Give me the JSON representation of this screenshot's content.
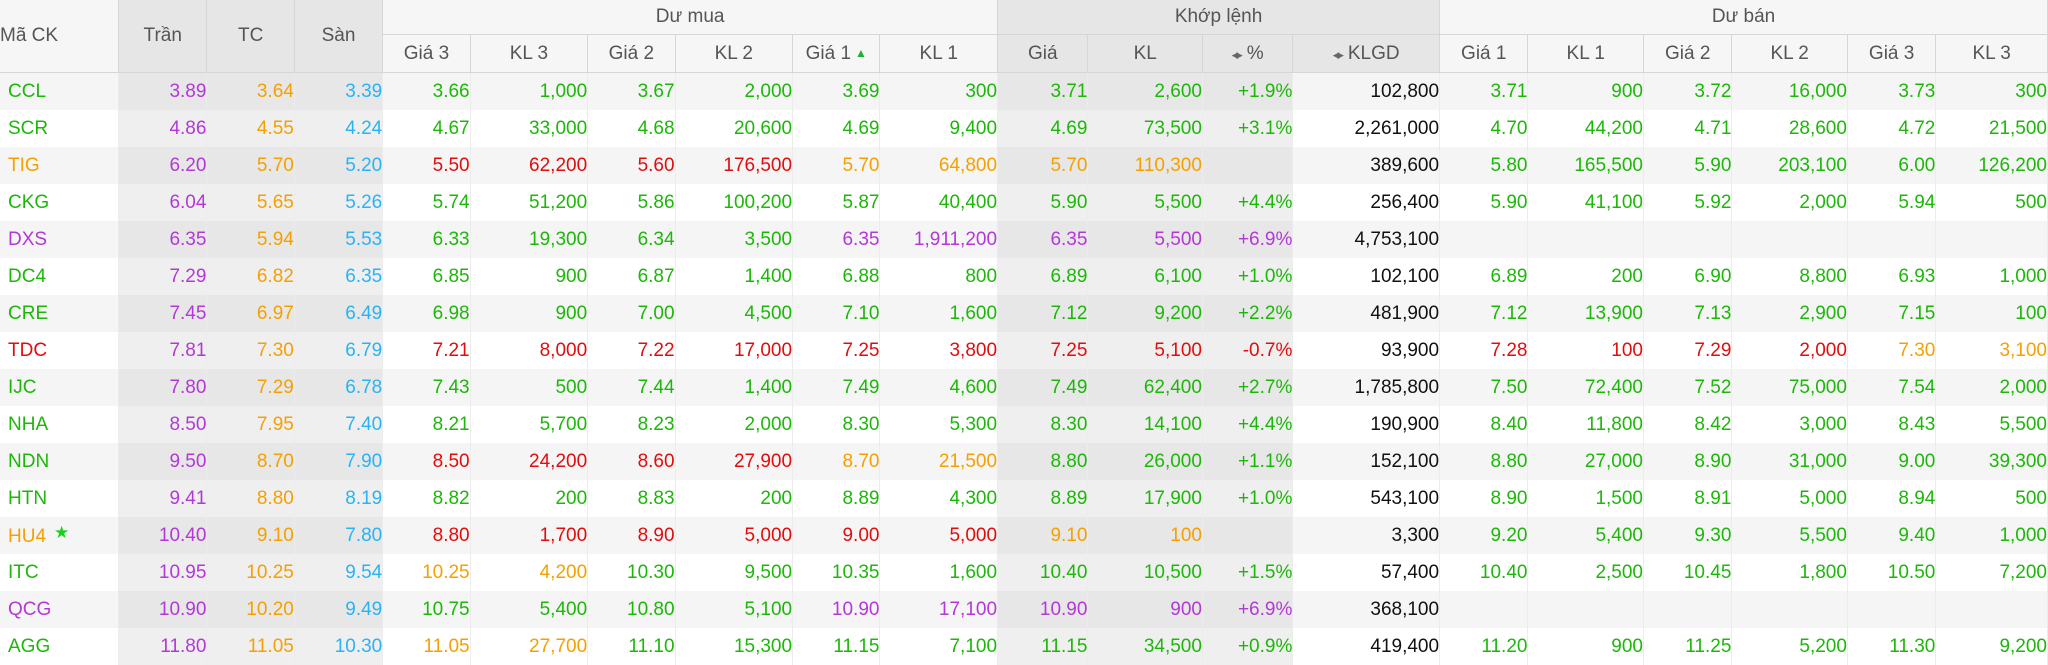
{
  "colors": {
    "g": "#1db70a",
    "r": "#e10d0d",
    "y": "#f5a000",
    "p": "#b438d8",
    "c": "#29b3f5",
    "k": "#111111"
  },
  "header": {
    "ma_ck": "Mã CK",
    "tran": "Trần",
    "tc": "TC",
    "san": "Sàn",
    "du_mua": "Dư mua",
    "khop_lenh": "Khớp lệnh",
    "du_ban": "Dư bán",
    "sort_icon": "◂▸",
    "buy_cols": [
      "Giá 3",
      "KL 3",
      "Giá 2",
      "KL 2",
      "Giá 1",
      "KL 1"
    ],
    "match_cols": [
      "Giá",
      "KL",
      "%",
      "KLGD"
    ],
    "sell_cols": [
      "Giá 1",
      "KL 1",
      "Giá 2",
      "KL 2",
      "Giá 3",
      "KL 3"
    ]
  },
  "rows": [
    {
      "sym": "CCL",
      "sc": "g",
      "star": false,
      "tran": "3.89",
      "tc": "3.64",
      "san": "3.39",
      "b": [
        [
          "3.66",
          "g"
        ],
        [
          "1,000",
          "g"
        ],
        [
          "3.67",
          "g"
        ],
        [
          "2,000",
          "g"
        ],
        [
          "3.69",
          "g"
        ],
        [
          "300",
          "g"
        ]
      ],
      "m": [
        [
          "3.71",
          "g"
        ],
        [
          "2,600",
          "g"
        ],
        [
          "+1.9%",
          "g"
        ]
      ],
      "klgd": "102,800",
      "s": [
        [
          "3.71",
          "g"
        ],
        [
          "900",
          "g"
        ],
        [
          "3.72",
          "g"
        ],
        [
          "16,000",
          "g"
        ],
        [
          "3.73",
          "g"
        ],
        [
          "300",
          "g"
        ]
      ]
    },
    {
      "sym": "SCR",
      "sc": "g",
      "star": false,
      "tran": "4.86",
      "tc": "4.55",
      "san": "4.24",
      "b": [
        [
          "4.67",
          "g"
        ],
        [
          "33,000",
          "g"
        ],
        [
          "4.68",
          "g"
        ],
        [
          "20,600",
          "g"
        ],
        [
          "4.69",
          "g"
        ],
        [
          "9,400",
          "g"
        ]
      ],
      "m": [
        [
          "4.69",
          "g"
        ],
        [
          "73,500",
          "g"
        ],
        [
          "+3.1%",
          "g"
        ]
      ],
      "klgd": "2,261,000",
      "s": [
        [
          "4.70",
          "g"
        ],
        [
          "44,200",
          "g"
        ],
        [
          "4.71",
          "g"
        ],
        [
          "28,600",
          "g"
        ],
        [
          "4.72",
          "g"
        ],
        [
          "21,500",
          "g"
        ]
      ]
    },
    {
      "sym": "TIG",
      "sc": "y",
      "star": false,
      "tran": "6.20",
      "tc": "5.70",
      "san": "5.20",
      "b": [
        [
          "5.50",
          "r"
        ],
        [
          "62,200",
          "r"
        ],
        [
          "5.60",
          "r"
        ],
        [
          "176,500",
          "r"
        ],
        [
          "5.70",
          "y"
        ],
        [
          "64,800",
          "y"
        ]
      ],
      "m": [
        [
          "5.70",
          "y"
        ],
        [
          "110,300",
          "y"
        ],
        [
          "",
          "y"
        ]
      ],
      "klgd": "389,600",
      "s": [
        [
          "5.80",
          "g"
        ],
        [
          "165,500",
          "g"
        ],
        [
          "5.90",
          "g"
        ],
        [
          "203,100",
          "g"
        ],
        [
          "6.00",
          "g"
        ],
        [
          "126,200",
          "g"
        ]
      ]
    },
    {
      "sym": "CKG",
      "sc": "g",
      "star": false,
      "tran": "6.04",
      "tc": "5.65",
      "san": "5.26",
      "b": [
        [
          "5.74",
          "g"
        ],
        [
          "51,200",
          "g"
        ],
        [
          "5.86",
          "g"
        ],
        [
          "100,200",
          "g"
        ],
        [
          "5.87",
          "g"
        ],
        [
          "40,400",
          "g"
        ]
      ],
      "m": [
        [
          "5.90",
          "g"
        ],
        [
          "5,500",
          "g"
        ],
        [
          "+4.4%",
          "g"
        ]
      ],
      "klgd": "256,400",
      "s": [
        [
          "5.90",
          "g"
        ],
        [
          "41,100",
          "g"
        ],
        [
          "5.92",
          "g"
        ],
        [
          "2,000",
          "g"
        ],
        [
          "5.94",
          "g"
        ],
        [
          "500",
          "g"
        ]
      ]
    },
    {
      "sym": "DXS",
      "sc": "p",
      "star": false,
      "tran": "6.35",
      "tc": "5.94",
      "san": "5.53",
      "b": [
        [
          "6.33",
          "g"
        ],
        [
          "19,300",
          "g"
        ],
        [
          "6.34",
          "g"
        ],
        [
          "3,500",
          "g"
        ],
        [
          "6.35",
          "p"
        ],
        [
          "1,911,200",
          "p"
        ]
      ],
      "m": [
        [
          "6.35",
          "p"
        ],
        [
          "5,500",
          "p"
        ],
        [
          "+6.9%",
          "p"
        ]
      ],
      "klgd": "4,753,100",
      "s": [
        [
          "",
          "g"
        ],
        [
          "",
          "g"
        ],
        [
          "",
          "g"
        ],
        [
          "",
          "g"
        ],
        [
          "",
          "g"
        ],
        [
          "",
          "g"
        ]
      ]
    },
    {
      "sym": "DC4",
      "sc": "g",
      "star": false,
      "tran": "7.29",
      "tc": "6.82",
      "san": "6.35",
      "b": [
        [
          "6.85",
          "g"
        ],
        [
          "900",
          "g"
        ],
        [
          "6.87",
          "g"
        ],
        [
          "1,400",
          "g"
        ],
        [
          "6.88",
          "g"
        ],
        [
          "800",
          "g"
        ]
      ],
      "m": [
        [
          "6.89",
          "g"
        ],
        [
          "6,100",
          "g"
        ],
        [
          "+1.0%",
          "g"
        ]
      ],
      "klgd": "102,100",
      "s": [
        [
          "6.89",
          "g"
        ],
        [
          "200",
          "g"
        ],
        [
          "6.90",
          "g"
        ],
        [
          "8,800",
          "g"
        ],
        [
          "6.93",
          "g"
        ],
        [
          "1,000",
          "g"
        ]
      ]
    },
    {
      "sym": "CRE",
      "sc": "g",
      "star": false,
      "tran": "7.45",
      "tc": "6.97",
      "san": "6.49",
      "b": [
        [
          "6.98",
          "g"
        ],
        [
          "900",
          "g"
        ],
        [
          "7.00",
          "g"
        ],
        [
          "4,500",
          "g"
        ],
        [
          "7.10",
          "g"
        ],
        [
          "1,600",
          "g"
        ]
      ],
      "m": [
        [
          "7.12",
          "g"
        ],
        [
          "9,200",
          "g"
        ],
        [
          "+2.2%",
          "g"
        ]
      ],
      "klgd": "481,900",
      "s": [
        [
          "7.12",
          "g"
        ],
        [
          "13,900",
          "g"
        ],
        [
          "7.13",
          "g"
        ],
        [
          "2,900",
          "g"
        ],
        [
          "7.15",
          "g"
        ],
        [
          "100",
          "g"
        ]
      ]
    },
    {
      "sym": "TDC",
      "sc": "r",
      "star": false,
      "tran": "7.81",
      "tc": "7.30",
      "san": "6.79",
      "b": [
        [
          "7.21",
          "r"
        ],
        [
          "8,000",
          "r"
        ],
        [
          "7.22",
          "r"
        ],
        [
          "17,000",
          "r"
        ],
        [
          "7.25",
          "r"
        ],
        [
          "3,800",
          "r"
        ]
      ],
      "m": [
        [
          "7.25",
          "r"
        ],
        [
          "5,100",
          "r"
        ],
        [
          "-0.7%",
          "r"
        ]
      ],
      "klgd": "93,900",
      "s": [
        [
          "7.28",
          "r"
        ],
        [
          "100",
          "r"
        ],
        [
          "7.29",
          "r"
        ],
        [
          "2,000",
          "r"
        ],
        [
          "7.30",
          "y"
        ],
        [
          "3,100",
          "y"
        ]
      ]
    },
    {
      "sym": "IJC",
      "sc": "g",
      "star": false,
      "tran": "7.80",
      "tc": "7.29",
      "san": "6.78",
      "b": [
        [
          "7.43",
          "g"
        ],
        [
          "500",
          "g"
        ],
        [
          "7.44",
          "g"
        ],
        [
          "1,400",
          "g"
        ],
        [
          "7.49",
          "g"
        ],
        [
          "4,600",
          "g"
        ]
      ],
      "m": [
        [
          "7.49",
          "g"
        ],
        [
          "62,400",
          "g"
        ],
        [
          "+2.7%",
          "g"
        ]
      ],
      "klgd": "1,785,800",
      "s": [
        [
          "7.50",
          "g"
        ],
        [
          "72,400",
          "g"
        ],
        [
          "7.52",
          "g"
        ],
        [
          "75,000",
          "g"
        ],
        [
          "7.54",
          "g"
        ],
        [
          "2,000",
          "g"
        ]
      ]
    },
    {
      "sym": "NHA",
      "sc": "g",
      "star": false,
      "tran": "8.50",
      "tc": "7.95",
      "san": "7.40",
      "b": [
        [
          "8.21",
          "g"
        ],
        [
          "5,700",
          "g"
        ],
        [
          "8.23",
          "g"
        ],
        [
          "2,000",
          "g"
        ],
        [
          "8.30",
          "g"
        ],
        [
          "5,300",
          "g"
        ]
      ],
      "m": [
        [
          "8.30",
          "g"
        ],
        [
          "14,100",
          "g"
        ],
        [
          "+4.4%",
          "g"
        ]
      ],
      "klgd": "190,900",
      "s": [
        [
          "8.40",
          "g"
        ],
        [
          "11,800",
          "g"
        ],
        [
          "8.42",
          "g"
        ],
        [
          "3,000",
          "g"
        ],
        [
          "8.43",
          "g"
        ],
        [
          "5,500",
          "g"
        ]
      ]
    },
    {
      "sym": "NDN",
      "sc": "g",
      "star": false,
      "tran": "9.50",
      "tc": "8.70",
      "san": "7.90",
      "b": [
        [
          "8.50",
          "r"
        ],
        [
          "24,200",
          "r"
        ],
        [
          "8.60",
          "r"
        ],
        [
          "27,900",
          "r"
        ],
        [
          "8.70",
          "y"
        ],
        [
          "21,500",
          "y"
        ]
      ],
      "m": [
        [
          "8.80",
          "g"
        ],
        [
          "26,000",
          "g"
        ],
        [
          "+1.1%",
          "g"
        ]
      ],
      "klgd": "152,100",
      "s": [
        [
          "8.80",
          "g"
        ],
        [
          "27,000",
          "g"
        ],
        [
          "8.90",
          "g"
        ],
        [
          "31,000",
          "g"
        ],
        [
          "9.00",
          "g"
        ],
        [
          "39,300",
          "g"
        ]
      ]
    },
    {
      "sym": "HTN",
      "sc": "g",
      "star": false,
      "tran": "9.41",
      "tc": "8.80",
      "san": "8.19",
      "b": [
        [
          "8.82",
          "g"
        ],
        [
          "200",
          "g"
        ],
        [
          "8.83",
          "g"
        ],
        [
          "200",
          "g"
        ],
        [
          "8.89",
          "g"
        ],
        [
          "4,300",
          "g"
        ]
      ],
      "m": [
        [
          "8.89",
          "g"
        ],
        [
          "17,900",
          "g"
        ],
        [
          "+1.0%",
          "g"
        ]
      ],
      "klgd": "543,100",
      "s": [
        [
          "8.90",
          "g"
        ],
        [
          "1,500",
          "g"
        ],
        [
          "8.91",
          "g"
        ],
        [
          "5,000",
          "g"
        ],
        [
          "8.94",
          "g"
        ],
        [
          "500",
          "g"
        ]
      ]
    },
    {
      "sym": "HU4",
      "sc": "y",
      "star": true,
      "tran": "10.40",
      "tc": "9.10",
      "san": "7.80",
      "b": [
        [
          "8.80",
          "r"
        ],
        [
          "1,700",
          "r"
        ],
        [
          "8.90",
          "r"
        ],
        [
          "5,000",
          "r"
        ],
        [
          "9.00",
          "r"
        ],
        [
          "5,000",
          "r"
        ]
      ],
      "m": [
        [
          "9.10",
          "y"
        ],
        [
          "100",
          "y"
        ],
        [
          "",
          "y"
        ]
      ],
      "klgd": "3,300",
      "s": [
        [
          "9.20",
          "g"
        ],
        [
          "5,400",
          "g"
        ],
        [
          "9.30",
          "g"
        ],
        [
          "5,500",
          "g"
        ],
        [
          "9.40",
          "g"
        ],
        [
          "1,000",
          "g"
        ]
      ]
    },
    {
      "sym": "ITC",
      "sc": "g",
      "star": false,
      "tran": "10.95",
      "tc": "10.25",
      "san": "9.54",
      "b": [
        [
          "10.25",
          "y"
        ],
        [
          "4,200",
          "y"
        ],
        [
          "10.30",
          "g"
        ],
        [
          "9,500",
          "g"
        ],
        [
          "10.35",
          "g"
        ],
        [
          "1,600",
          "g"
        ]
      ],
      "m": [
        [
          "10.40",
          "g"
        ],
        [
          "10,500",
          "g"
        ],
        [
          "+1.5%",
          "g"
        ]
      ],
      "klgd": "57,400",
      "s": [
        [
          "10.40",
          "g"
        ],
        [
          "2,500",
          "g"
        ],
        [
          "10.45",
          "g"
        ],
        [
          "1,800",
          "g"
        ],
        [
          "10.50",
          "g"
        ],
        [
          "7,200",
          "g"
        ]
      ]
    },
    {
      "sym": "QCG",
      "sc": "p",
      "star": false,
      "tran": "10.90",
      "tc": "10.20",
      "san": "9.49",
      "b": [
        [
          "10.75",
          "g"
        ],
        [
          "5,400",
          "g"
        ],
        [
          "10.80",
          "g"
        ],
        [
          "5,100",
          "g"
        ],
        [
          "10.90",
          "p"
        ],
        [
          "17,100",
          "p"
        ]
      ],
      "m": [
        [
          "10.90",
          "p"
        ],
        [
          "900",
          "p"
        ],
        [
          "+6.9%",
          "p"
        ]
      ],
      "klgd": "368,100",
      "s": [
        [
          "",
          "g"
        ],
        [
          "",
          "g"
        ],
        [
          "",
          "g"
        ],
        [
          "",
          "g"
        ],
        [
          "",
          "g"
        ],
        [
          "",
          "g"
        ]
      ]
    },
    {
      "sym": "AGG",
      "sc": "g",
      "star": false,
      "tran": "11.80",
      "tc": "11.05",
      "san": "10.30",
      "b": [
        [
          "11.05",
          "y"
        ],
        [
          "27,700",
          "y"
        ],
        [
          "11.10",
          "g"
        ],
        [
          "15,300",
          "g"
        ],
        [
          "11.15",
          "g"
        ],
        [
          "7,100",
          "g"
        ]
      ],
      "m": [
        [
          "11.15",
          "g"
        ],
        [
          "34,500",
          "g"
        ],
        [
          "+0.9%",
          "g"
        ]
      ],
      "klgd": "419,400",
      "s": [
        [
          "11.20",
          "g"
        ],
        [
          "900",
          "g"
        ],
        [
          "11.25",
          "g"
        ],
        [
          "5,200",
          "g"
        ],
        [
          "11.30",
          "g"
        ],
        [
          "9,200",
          "g"
        ]
      ]
    }
  ]
}
